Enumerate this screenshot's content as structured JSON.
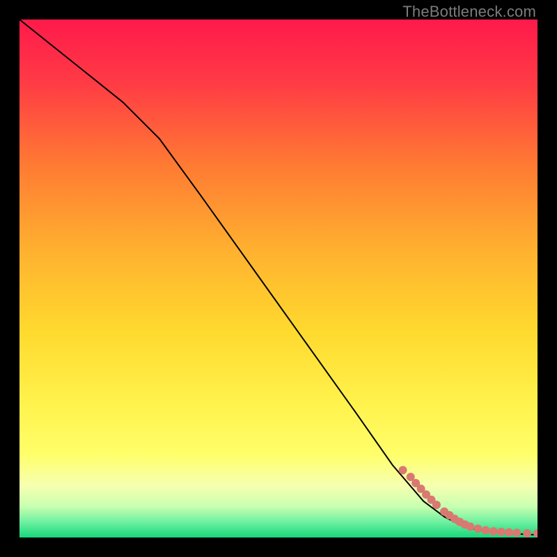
{
  "watermark": "TheBottleneck.com",
  "chart_data": {
    "type": "line",
    "title": "",
    "xlabel": "",
    "ylabel": "",
    "xlim": [
      0,
      100
    ],
    "ylim": [
      0,
      100
    ],
    "grid": false,
    "legend": false,
    "background_gradient": {
      "top_color": "#ff1a4b",
      "mid_colors": [
        "#ff7a33",
        "#ffd92e",
        "#ffff57",
        "#f6ffb0"
      ],
      "bottom_color": "#17d77a"
    },
    "series": [
      {
        "name": "bottleneck-curve",
        "color": "#000000",
        "stroke_width": 2,
        "x": [
          0,
          10,
          20,
          27,
          35,
          45,
          55,
          65,
          72,
          78,
          82,
          86,
          90,
          94,
          98,
          100
        ],
        "y": [
          100,
          92,
          84,
          77,
          66,
          52,
          38,
          24,
          14,
          7,
          4,
          2,
          1.2,
          0.8,
          0.6,
          0.5
        ]
      }
    ],
    "scatter": {
      "name": "data-points",
      "color": "#d87a71",
      "radius": 6,
      "x": [
        74,
        75.5,
        76.5,
        77.5,
        78.5,
        79.5,
        80.5,
        82,
        83,
        84,
        85,
        86,
        87,
        88.5,
        90,
        91.5,
        93,
        94.5,
        96,
        98,
        100
      ],
      "y": [
        13,
        11.7,
        10.5,
        9.4,
        8.3,
        7.3,
        6.3,
        5,
        4.3,
        3.6,
        3,
        2.5,
        2.1,
        1.7,
        1.4,
        1.2,
        1.1,
        1,
        0.9,
        0.8,
        0.8
      ]
    }
  }
}
